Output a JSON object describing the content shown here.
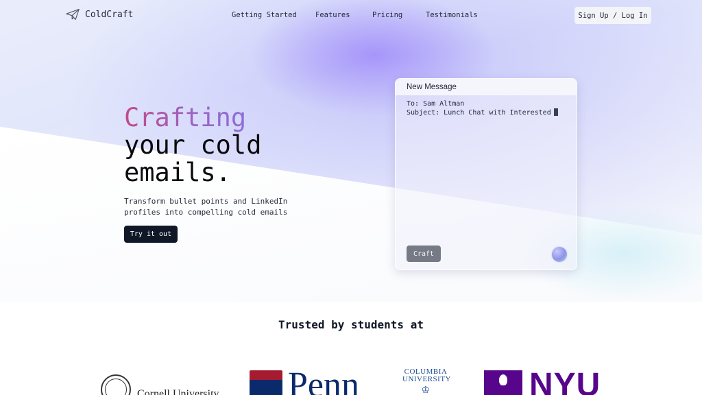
{
  "nav": {
    "brand": "ColdCraft",
    "links": [
      {
        "label": "Getting Started"
      },
      {
        "label": "Features"
      },
      {
        "label": "Pricing"
      },
      {
        "label": "Testimonials"
      }
    ],
    "signup_label": "Sign Up / Log In"
  },
  "hero": {
    "title_highlight": "Crafting",
    "title_line2": "your cold",
    "title_line3": "emails.",
    "subtitle": "Transform bullet points and LinkedIn profiles into compelling cold emails",
    "cta_label": "Try it out"
  },
  "composer": {
    "header": "New Message",
    "to_line": "To: Sam Altman",
    "subject_line": "Subject: Lunch Chat with Interested",
    "craft_label": "Craft"
  },
  "trusted": {
    "heading": "Trusted by students at",
    "logos": [
      {
        "name": "Cornell University"
      },
      {
        "name": "Penn"
      },
      {
        "name": "COLUMBIA UNIVERSITY",
        "line1": "COLUMBIA",
        "line2": "UNIVERSITY"
      },
      {
        "name": "NYU"
      }
    ]
  },
  "colors": {
    "title_gradient_start": "#c04c86",
    "title_gradient_end": "#8c6fd8",
    "cta_bg": "#101828",
    "craft_bg": "#767a85",
    "penn_blue": "#0b2a6b",
    "penn_red": "#a51c30",
    "columbia_blue": "#1c4a8f",
    "nyu_purple": "#57068c"
  },
  "icons": {
    "brand": "paper-plane-icon",
    "craft_orb": "gradient-orb-icon"
  }
}
